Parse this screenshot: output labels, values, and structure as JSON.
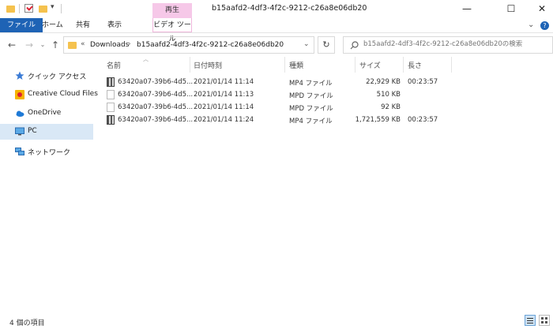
{
  "window": {
    "title": "b15aafd2-4df3-4f2c-9212-c26a8e06db20",
    "contextual_group": "再生",
    "controls": {
      "minimize": "—",
      "maximize": "☐",
      "close": "✕"
    }
  },
  "ribbon": {
    "tabs": [
      "ファイル",
      "ホーム",
      "共有",
      "表示",
      "ビデオ ツール"
    ],
    "expand_glyph": "⌄",
    "help_glyph": "?"
  },
  "address": {
    "overflow": "«",
    "crumbs": [
      "Downloads",
      "b15aafd2-4df3-4f2c-9212-c26a8e06db20"
    ],
    "separator": "›"
  },
  "search": {
    "placeholder": "b15aafd2-4df3-4f2c-9212-c26a8e06db20の検索"
  },
  "nav_pane": {
    "items": [
      {
        "label": "クイック アクセス",
        "icon": "star-icon"
      },
      {
        "label": "Creative Cloud Files",
        "icon": "creative-cloud-icon"
      },
      {
        "label": "OneDrive",
        "icon": "cloud-icon"
      },
      {
        "label": "PC",
        "icon": "monitor-icon",
        "selected": true
      },
      {
        "label": "ネットワーク",
        "icon": "network-icon"
      }
    ]
  },
  "columns": {
    "name": "名前",
    "date": "日付時刻",
    "type": "種類",
    "size": "サイズ",
    "length": "長さ"
  },
  "files": [
    {
      "name": "63420a07-39b6-4d5...",
      "date": "2021/01/14 11:14",
      "type": "MP4 ファイル",
      "size": "22,929 KB",
      "length": "00:23:57",
      "kind": "mp4"
    },
    {
      "name": "63420a07-39b6-4d5...",
      "date": "2021/01/14 11:13",
      "type": "MPD ファイル",
      "size": "510 KB",
      "length": "",
      "kind": "mpd"
    },
    {
      "name": "63420a07-39b6-4d5...",
      "date": "2021/01/14 11:14",
      "type": "MPD ファイル",
      "size": "92 KB",
      "length": "",
      "kind": "mpd"
    },
    {
      "name": "63420a07-39b6-4d5...",
      "date": "2021/01/14 11:24",
      "type": "MP4 ファイル",
      "size": "1,721,559 KB",
      "length": "00:23:57",
      "kind": "mp4"
    }
  ],
  "status": {
    "item_count": "4 個の項目"
  },
  "colors": {
    "file_tab": "#1e63b5",
    "context_tab": "#f6c8e8",
    "selected_nav": "#d9e8f6"
  }
}
